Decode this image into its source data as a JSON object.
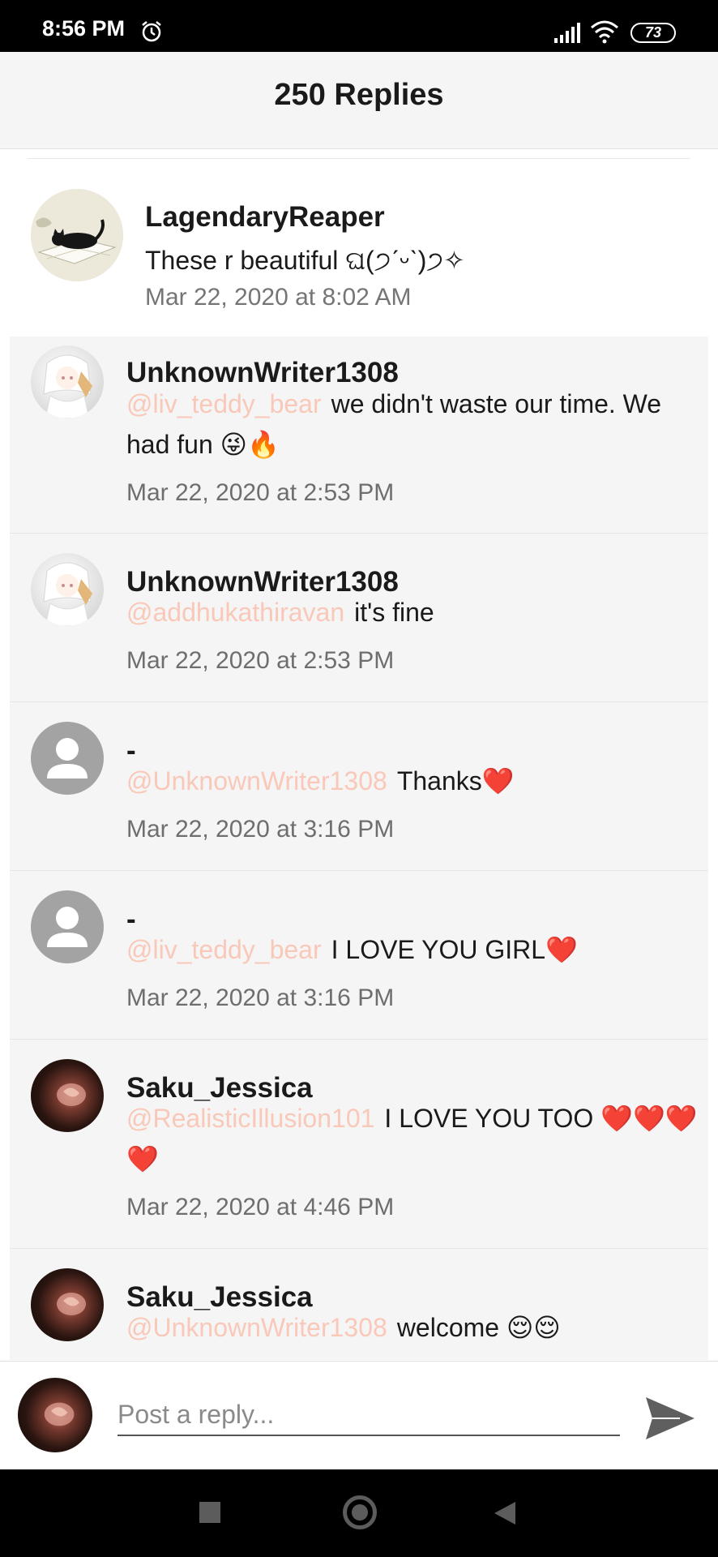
{
  "status_bar": {
    "time": "8:56 PM",
    "battery": "73",
    "icons": [
      "alarm-icon",
      "signal-icon",
      "wifi-icon",
      "battery-icon"
    ]
  },
  "header": {
    "title": "250 Replies"
  },
  "parent_comment": {
    "username": "LagendaryReaper",
    "text": "These r beautiful ଘ(੭ˊᵕˋ)੭✧",
    "timestamp": "Mar 22, 2020 at 8:02 AM",
    "avatar": "black-cat-on-book-avatar"
  },
  "replies": [
    {
      "username": "UnknownWriter1308",
      "mention": "@liv_teddy_bear",
      "text": "we didn't waste our time. We had fun 😜🔥",
      "timestamp": "Mar 22, 2020 at 2:53 PM",
      "avatar": "anime-girl-avatar"
    },
    {
      "username": "UnknownWriter1308",
      "mention": "@addhukathiravan",
      "text": "it's fine",
      "timestamp": "Mar 22, 2020 at 2:53 PM",
      "avatar": "anime-girl-avatar"
    },
    {
      "username": "-",
      "mention": "@UnknownWriter1308",
      "text": "Thanks❤️",
      "timestamp": "Mar 22, 2020 at 3:16 PM",
      "avatar": "default-user-avatar"
    },
    {
      "username": "-",
      "mention": "@liv_teddy_bear",
      "text": "I LOVE YOU GIRL❤️",
      "timestamp": "Mar 22, 2020 at 3:16 PM",
      "avatar": "default-user-avatar"
    },
    {
      "username": "Saku_Jessica",
      "mention": "@RealisticIllusion101",
      "text": "I LOVE YOU TOO ❤️❤️❤️❤️",
      "timestamp": "Mar 22, 2020 at 4:46 PM",
      "avatar": "rose-avatar"
    },
    {
      "username": "Saku_Jessica",
      "mention": "@UnknownWriter1308",
      "text": "welcome 😌😌",
      "timestamp": "",
      "avatar": "rose-avatar"
    }
  ],
  "reply_input": {
    "placeholder": "Post a reply...",
    "value": "",
    "avatar": "rose-avatar"
  },
  "colors": {
    "mention": "#f9c8b8",
    "reply_background": "#f5f5f5",
    "header_background": "#f5f5f5"
  }
}
